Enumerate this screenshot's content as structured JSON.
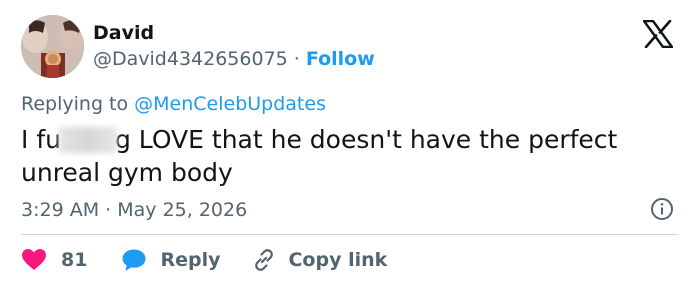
{
  "author": {
    "name": "David",
    "handle": "@David4342656075",
    "separator": "·",
    "follow_label": "Follow"
  },
  "reply_context": {
    "prefix": "Replying to ",
    "mention": "@MenCelebUpdates"
  },
  "tweet": {
    "text_start": "I fu",
    "text_censored": "",
    "text_end": "g LOVE that he doesn't have the perfect unreal gym body"
  },
  "meta": {
    "time": "3:29 AM",
    "separator": "·",
    "date": "May 25, 2026"
  },
  "actions": {
    "like_count": "81",
    "reply_label": "Reply",
    "copy_label": "Copy link"
  },
  "colors": {
    "like": "#f91880",
    "reply": "#1d9bf0",
    "link": "#1d9bf0",
    "muted": "#536471",
    "text": "#0f1419"
  },
  "icons": [
    "x-logo-icon",
    "info-icon",
    "heart-icon",
    "reply-bubble-icon",
    "link-icon"
  ]
}
